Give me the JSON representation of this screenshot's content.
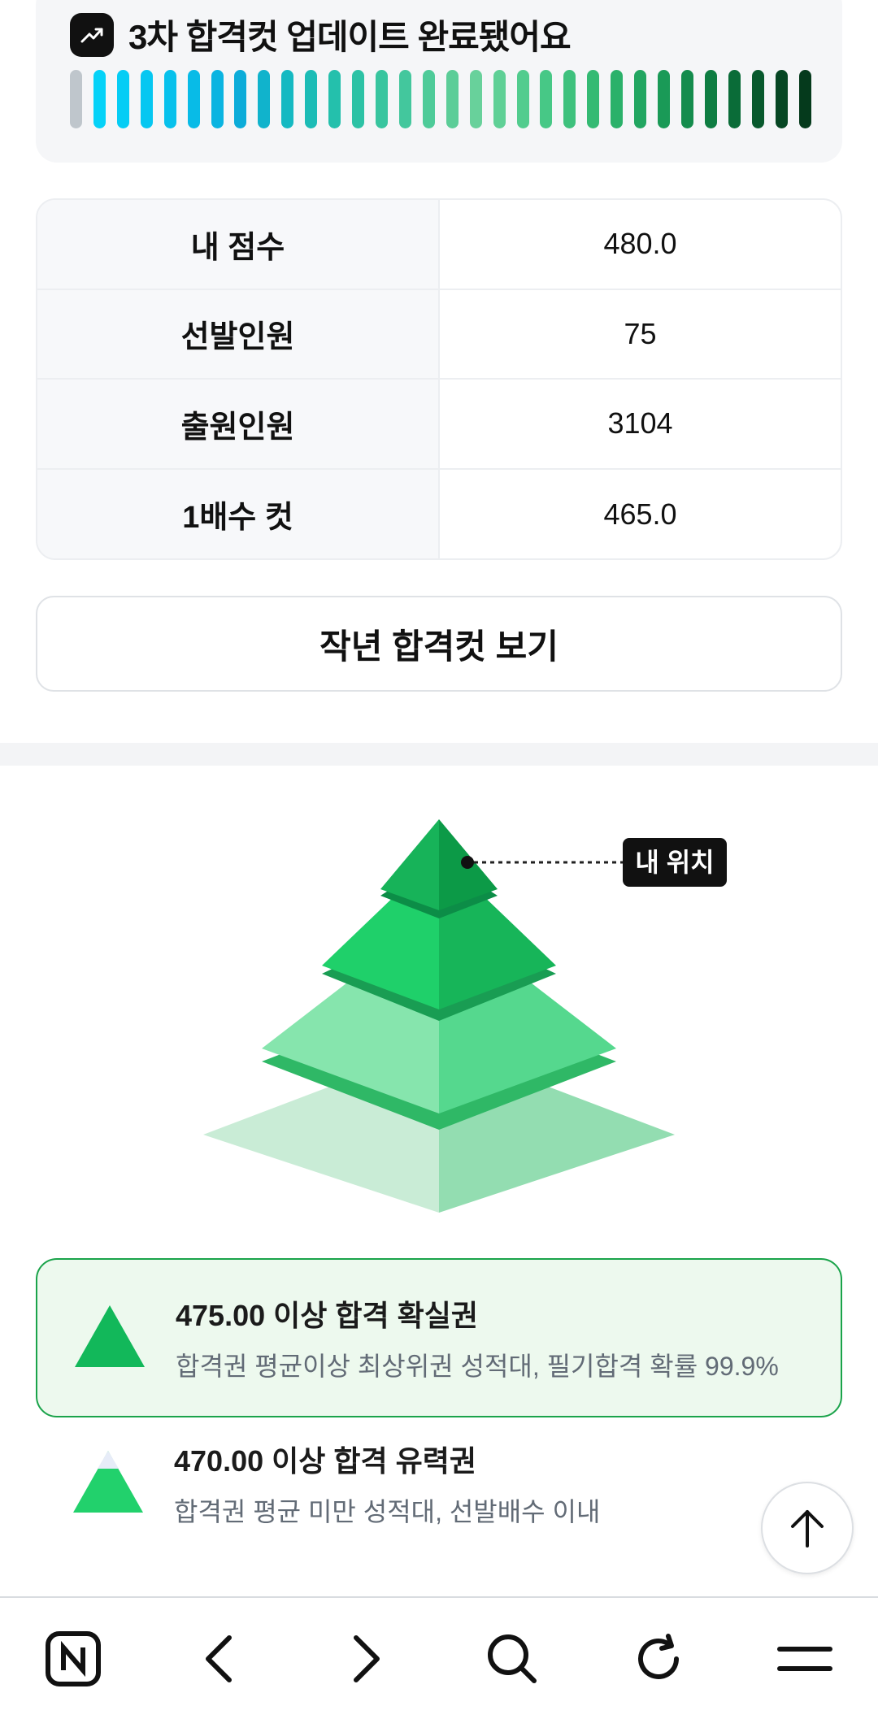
{
  "update": {
    "title": "3차 합격컷 업데이트 완료됐어요",
    "icon": "trend-up-icon",
    "bar_colors": [
      "#bfc6cc",
      "#05d2f8",
      "#05cdf5",
      "#06c7f1",
      "#07c1ec",
      "#08bbe7",
      "#0ab4e1",
      "#0cacd9",
      "#10b3cc",
      "#15b9c2",
      "#1cbcb6",
      "#24c0ac",
      "#2cc2a5",
      "#38c59f",
      "#43c79d",
      "#4ecb99",
      "#5ccd98",
      "#68d19b",
      "#5fd096",
      "#52cc8e",
      "#47c886",
      "#3ec17d",
      "#34ba73",
      "#2bb16a",
      "#22a661",
      "#1a9a57",
      "#148c4d",
      "#0e7d42",
      "#0a6c38",
      "#08592d",
      "#064623",
      "#053a1c"
    ]
  },
  "info_table": {
    "rows": [
      {
        "label": "내 점수",
        "value": "480.0"
      },
      {
        "label": "선발인원",
        "value": "75"
      },
      {
        "label": "출원인원",
        "value": "3104"
      },
      {
        "label": "1배수 컷",
        "value": "465.0"
      }
    ]
  },
  "lastyear_button": "작년 합격컷 보기",
  "pyramid": {
    "marker_label": "내 위치"
  },
  "tiers": [
    {
      "title": "475.00 이상 합격 확실권",
      "desc": "합격권 평균이상 최상위권 성적대, 필기합격 확률 99.9%"
    },
    {
      "title": "470.00 이상 합격 유력권",
      "desc": "합격권 평균 미만 성적대, 선발배수 이내"
    }
  ],
  "colors": {
    "accent": "#1aa34a",
    "active_bg": "#edf9ee"
  }
}
